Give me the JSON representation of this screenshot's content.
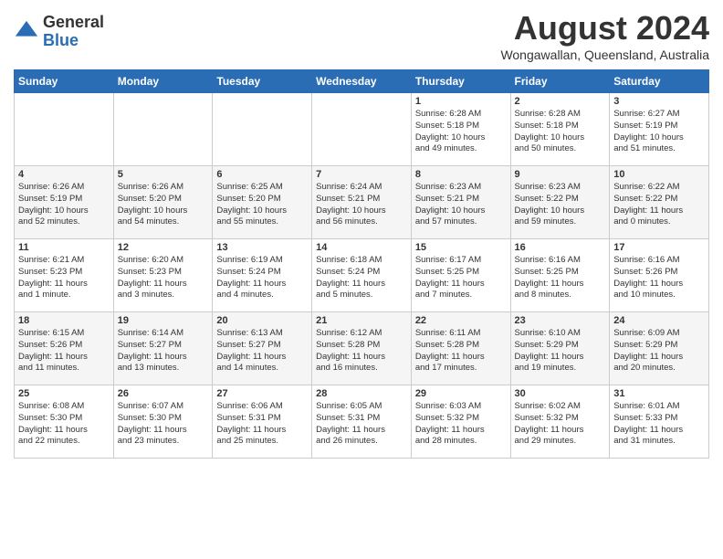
{
  "header": {
    "logo_general": "General",
    "logo_blue": "Blue",
    "month_year": "August 2024",
    "location": "Wongawallan, Queensland, Australia"
  },
  "weekdays": [
    "Sunday",
    "Monday",
    "Tuesday",
    "Wednesday",
    "Thursday",
    "Friday",
    "Saturday"
  ],
  "weeks": [
    [
      {
        "day": "",
        "info": ""
      },
      {
        "day": "",
        "info": ""
      },
      {
        "day": "",
        "info": ""
      },
      {
        "day": "",
        "info": ""
      },
      {
        "day": "1",
        "info": "Sunrise: 6:28 AM\nSunset: 5:18 PM\nDaylight: 10 hours\nand 49 minutes."
      },
      {
        "day": "2",
        "info": "Sunrise: 6:28 AM\nSunset: 5:18 PM\nDaylight: 10 hours\nand 50 minutes."
      },
      {
        "day": "3",
        "info": "Sunrise: 6:27 AM\nSunset: 5:19 PM\nDaylight: 10 hours\nand 51 minutes."
      }
    ],
    [
      {
        "day": "4",
        "info": "Sunrise: 6:26 AM\nSunset: 5:19 PM\nDaylight: 10 hours\nand 52 minutes."
      },
      {
        "day": "5",
        "info": "Sunrise: 6:26 AM\nSunset: 5:20 PM\nDaylight: 10 hours\nand 54 minutes."
      },
      {
        "day": "6",
        "info": "Sunrise: 6:25 AM\nSunset: 5:20 PM\nDaylight: 10 hours\nand 55 minutes."
      },
      {
        "day": "7",
        "info": "Sunrise: 6:24 AM\nSunset: 5:21 PM\nDaylight: 10 hours\nand 56 minutes."
      },
      {
        "day": "8",
        "info": "Sunrise: 6:23 AM\nSunset: 5:21 PM\nDaylight: 10 hours\nand 57 minutes."
      },
      {
        "day": "9",
        "info": "Sunrise: 6:23 AM\nSunset: 5:22 PM\nDaylight: 10 hours\nand 59 minutes."
      },
      {
        "day": "10",
        "info": "Sunrise: 6:22 AM\nSunset: 5:22 PM\nDaylight: 11 hours\nand 0 minutes."
      }
    ],
    [
      {
        "day": "11",
        "info": "Sunrise: 6:21 AM\nSunset: 5:23 PM\nDaylight: 11 hours\nand 1 minute."
      },
      {
        "day": "12",
        "info": "Sunrise: 6:20 AM\nSunset: 5:23 PM\nDaylight: 11 hours\nand 3 minutes."
      },
      {
        "day": "13",
        "info": "Sunrise: 6:19 AM\nSunset: 5:24 PM\nDaylight: 11 hours\nand 4 minutes."
      },
      {
        "day": "14",
        "info": "Sunrise: 6:18 AM\nSunset: 5:24 PM\nDaylight: 11 hours\nand 5 minutes."
      },
      {
        "day": "15",
        "info": "Sunrise: 6:17 AM\nSunset: 5:25 PM\nDaylight: 11 hours\nand 7 minutes."
      },
      {
        "day": "16",
        "info": "Sunrise: 6:16 AM\nSunset: 5:25 PM\nDaylight: 11 hours\nand 8 minutes."
      },
      {
        "day": "17",
        "info": "Sunrise: 6:16 AM\nSunset: 5:26 PM\nDaylight: 11 hours\nand 10 minutes."
      }
    ],
    [
      {
        "day": "18",
        "info": "Sunrise: 6:15 AM\nSunset: 5:26 PM\nDaylight: 11 hours\nand 11 minutes."
      },
      {
        "day": "19",
        "info": "Sunrise: 6:14 AM\nSunset: 5:27 PM\nDaylight: 11 hours\nand 13 minutes."
      },
      {
        "day": "20",
        "info": "Sunrise: 6:13 AM\nSunset: 5:27 PM\nDaylight: 11 hours\nand 14 minutes."
      },
      {
        "day": "21",
        "info": "Sunrise: 6:12 AM\nSunset: 5:28 PM\nDaylight: 11 hours\nand 16 minutes."
      },
      {
        "day": "22",
        "info": "Sunrise: 6:11 AM\nSunset: 5:28 PM\nDaylight: 11 hours\nand 17 minutes."
      },
      {
        "day": "23",
        "info": "Sunrise: 6:10 AM\nSunset: 5:29 PM\nDaylight: 11 hours\nand 19 minutes."
      },
      {
        "day": "24",
        "info": "Sunrise: 6:09 AM\nSunset: 5:29 PM\nDaylight: 11 hours\nand 20 minutes."
      }
    ],
    [
      {
        "day": "25",
        "info": "Sunrise: 6:08 AM\nSunset: 5:30 PM\nDaylight: 11 hours\nand 22 minutes."
      },
      {
        "day": "26",
        "info": "Sunrise: 6:07 AM\nSunset: 5:30 PM\nDaylight: 11 hours\nand 23 minutes."
      },
      {
        "day": "27",
        "info": "Sunrise: 6:06 AM\nSunset: 5:31 PM\nDaylight: 11 hours\nand 25 minutes."
      },
      {
        "day": "28",
        "info": "Sunrise: 6:05 AM\nSunset: 5:31 PM\nDaylight: 11 hours\nand 26 minutes."
      },
      {
        "day": "29",
        "info": "Sunrise: 6:03 AM\nSunset: 5:32 PM\nDaylight: 11 hours\nand 28 minutes."
      },
      {
        "day": "30",
        "info": "Sunrise: 6:02 AM\nSunset: 5:32 PM\nDaylight: 11 hours\nand 29 minutes."
      },
      {
        "day": "31",
        "info": "Sunrise: 6:01 AM\nSunset: 5:33 PM\nDaylight: 11 hours\nand 31 minutes."
      }
    ]
  ]
}
